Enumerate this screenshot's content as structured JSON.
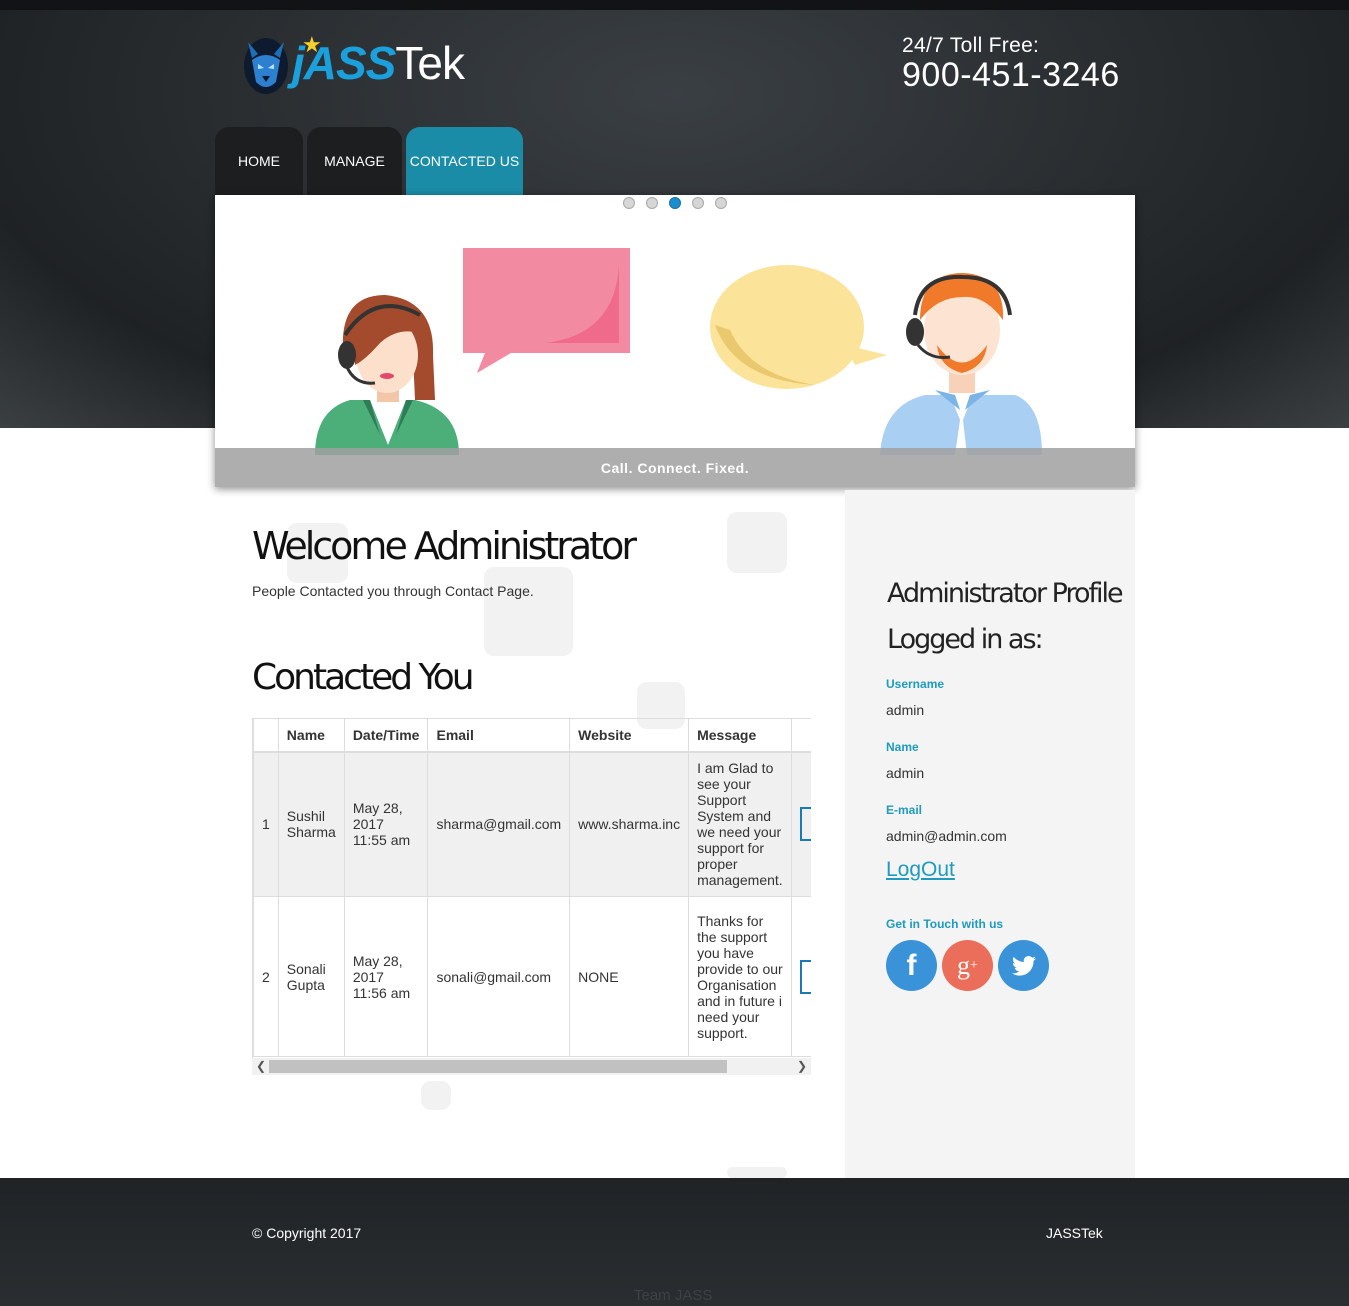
{
  "brand": {
    "logo_prefix": "jASS",
    "logo_suffix": "Tek"
  },
  "header": {
    "toll_label": "24/7 Toll Free:",
    "toll_number": "900-451-3246"
  },
  "nav": {
    "home": "HOME",
    "manage": "MANAGE",
    "contacted_us": "CONTACTED US",
    "active": "CONTACTED US"
  },
  "slider": {
    "active_dot": 3,
    "dot_count": 5,
    "caption": "Call. Connect. Fixed."
  },
  "main": {
    "welcome": "Welcome Administrator",
    "subtitle": "People Contacted you through Contact Page.",
    "section_title": "Contacted You"
  },
  "table": {
    "headers": [
      "",
      "Name",
      "Date/Time",
      "Email",
      "Website",
      "Message",
      ""
    ],
    "rows": [
      {
        "index": "1",
        "name": "Sushil Sharma",
        "date": "May 28, 2017 11:55 am",
        "email": "sharma@gmail.com",
        "website": "www.sharma.inc",
        "message": "I am Glad to see your Support System and we need your support for proper management."
      },
      {
        "index": "2",
        "name": "Sonali Gupta",
        "date": "May 28, 2017 11:56 am",
        "email": "sonali@gmail.com",
        "website": "NONE",
        "message": "Thanks for the support you have provide to our Organisation and in future i need your support."
      }
    ]
  },
  "sidebar": {
    "title": "Administrator Profile",
    "logged_in": "Logged in as:",
    "username_label": "Username",
    "username": "admin",
    "name_label": "Name",
    "name": "admin",
    "email_label": "E-mail",
    "email": "admin@admin.com",
    "logout": "LogOut",
    "social_heading": "Get in Touch with us",
    "social_icons": [
      "facebook-icon",
      "google-plus-icon",
      "twitter-icon"
    ]
  },
  "footer": {
    "copyright": "© Copyright 2017",
    "brand": "JASSTek",
    "team": "Team JASS"
  },
  "colors": {
    "accent": "#1a8ca7",
    "link": "#1e9bbe",
    "facebook": "#3a93d8",
    "google": "#ea6e5a",
    "twitter": "#3a93d8"
  }
}
